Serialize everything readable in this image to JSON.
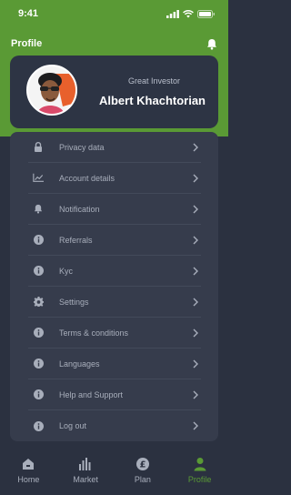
{
  "status_bar": {
    "time": "9:41"
  },
  "header": {
    "title": "Profile"
  },
  "profile": {
    "role": "Great Investor",
    "name": "Albert Khachtorian"
  },
  "menu": {
    "items": [
      {
        "label": "Privacy data",
        "icon": "lock-icon"
      },
      {
        "label": "Account details",
        "icon": "chart-line-icon"
      },
      {
        "label": "Notification",
        "icon": "bell-icon"
      },
      {
        "label": "Referrals",
        "icon": "info-icon"
      },
      {
        "label": "Kyc",
        "icon": "info-icon"
      },
      {
        "label": "Settings",
        "icon": "gear-icon"
      },
      {
        "label": "Terms & conditions",
        "icon": "info-icon"
      },
      {
        "label": "Languages",
        "icon": "info-icon"
      },
      {
        "label": "Help and Support",
        "icon": "info-icon"
      },
      {
        "label": "Log out",
        "icon": "info-icon"
      }
    ]
  },
  "tab_bar": {
    "tabs": [
      {
        "label": "Home",
        "icon": "home-icon"
      },
      {
        "label": "Market",
        "icon": "bar-chart-icon"
      },
      {
        "label": "Plan",
        "icon": "pound-coin-icon"
      },
      {
        "label": "Profile",
        "icon": "user-icon",
        "active": true
      }
    ]
  },
  "colors": {
    "accent": "#5a9a35",
    "background": "#2b3140",
    "panel": "#363c4c",
    "card": "#2d3444",
    "muted_text": "#a8aebb"
  }
}
